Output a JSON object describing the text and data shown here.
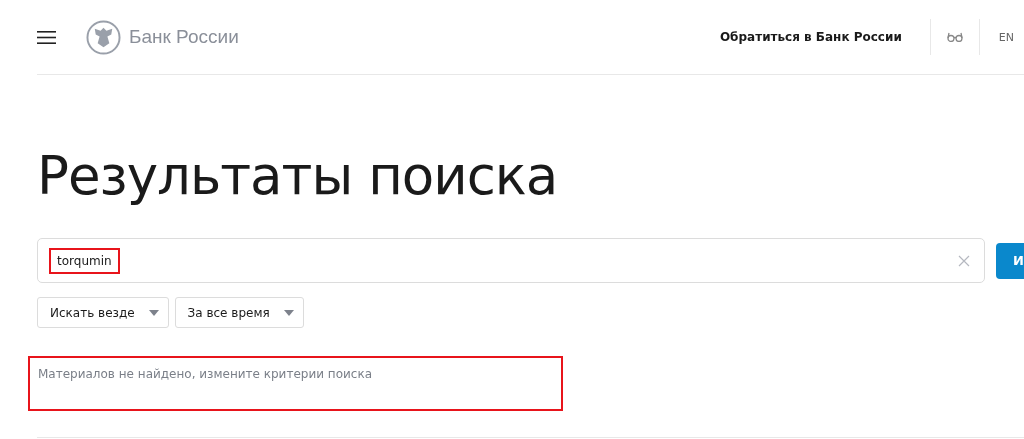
{
  "header": {
    "logo_text": "Банк России",
    "contact_link": "Обратиться в Банк России",
    "language": {
      "label": "EN",
      "selected": false
    }
  },
  "title": "Результаты поиска",
  "search": {
    "value": "torqumin",
    "highlighted": true,
    "button": "И"
  },
  "filters": [
    {
      "label": "Искать везде"
    },
    {
      "label": "За все время"
    }
  ],
  "message": {
    "text": "Материалов не найдено, измените критерии поиска",
    "highlighted": true
  }
}
